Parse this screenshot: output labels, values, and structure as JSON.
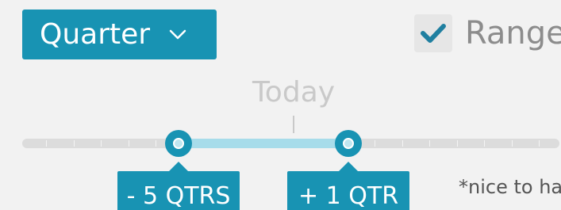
{
  "period_selector": {
    "value": "Quarter",
    "icon": "chevron-down-icon"
  },
  "range_toggle": {
    "label": "Range",
    "checked": true,
    "icon": "check-icon"
  },
  "timeline": {
    "today_label": "Today",
    "start_offset_label": "- 5 QTRS",
    "end_offset_label": "+ 1 QTR"
  },
  "note": "*nice to ha",
  "colors": {
    "accent": "#1893b3",
    "range_fill": "#a7dcea",
    "track": "#dcdcdc",
    "muted_text": "#c9c9c9",
    "background": "#f2f2f2"
  }
}
